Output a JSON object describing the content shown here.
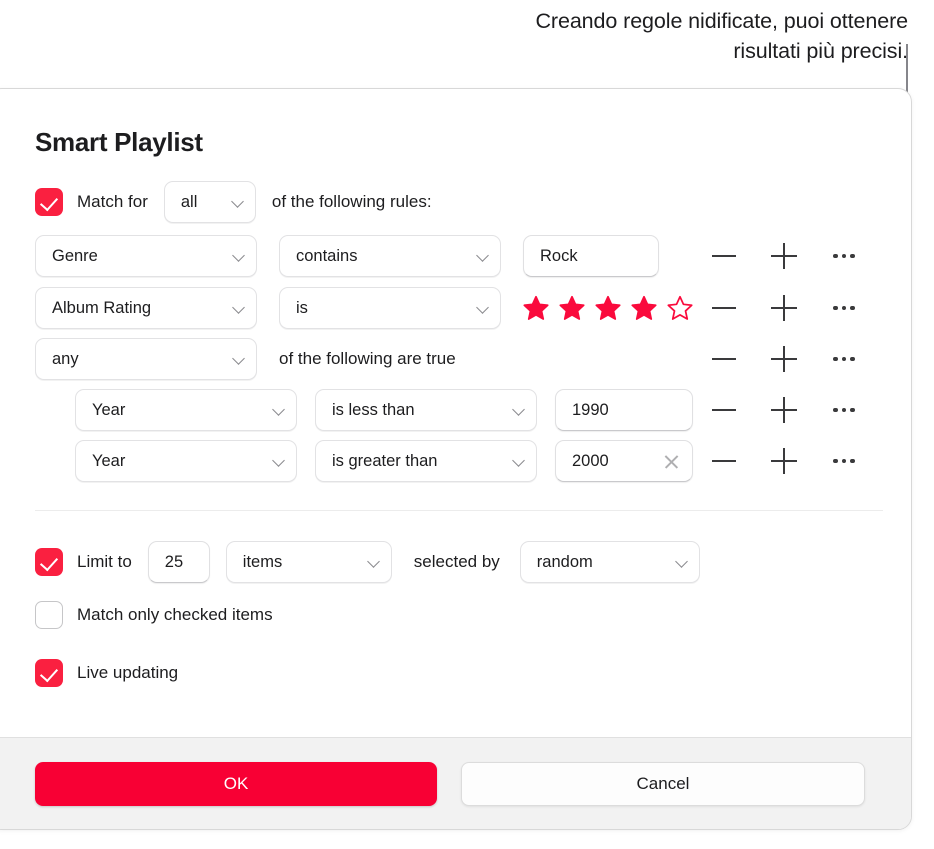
{
  "callout": {
    "text": "Creando regole nidificate, puoi ottenere risultati più precisi."
  },
  "dialog": {
    "title": "Smart Playlist",
    "match": {
      "checked": true,
      "label": "Match  for",
      "selected": "all",
      "suffix": "of the following rules:"
    },
    "rules": [
      {
        "field": "Genre",
        "operator": "contains",
        "value": "Rock",
        "value_kind": "text",
        "nested": false
      },
      {
        "field": "Album Rating",
        "operator": "is",
        "value_kind": "stars",
        "stars_filled": 4,
        "stars_total": 5,
        "nested": false
      },
      {
        "field": "any",
        "group_suffix": "of the following are true",
        "value_kind": "group",
        "nested": false
      },
      {
        "field": "Year",
        "operator": "is less than",
        "value": "1990",
        "value_kind": "text",
        "nested": true,
        "clearable": false
      },
      {
        "field": "Year",
        "operator": "is greater than",
        "value": "2000",
        "value_kind": "text",
        "nested": true,
        "clearable": true
      }
    ],
    "limit": {
      "checked": true,
      "label": "Limit to",
      "amount": "25",
      "unit": "items",
      "by_label": "selected by",
      "selected_by": "random"
    },
    "options": [
      {
        "label": "Match only checked items",
        "checked": false
      },
      {
        "label": "Live updating",
        "checked": true
      }
    ],
    "footer": {
      "ok_label": "OK",
      "cancel_label": "Cancel"
    }
  },
  "colors": {
    "accent_red": "#fa2040",
    "ok_red": "#f80034",
    "star_red": "#fa0a3c",
    "callout_gray": "#86868b",
    "footer_bg": "#f2f2f2"
  }
}
